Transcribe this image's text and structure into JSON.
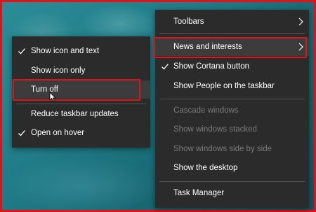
{
  "context_menu": {
    "items": [
      {
        "label": "Toolbars",
        "checked": false,
        "disabled": false,
        "has_submenu": true
      },
      {
        "label": "News and interests",
        "checked": false,
        "disabled": false,
        "has_submenu": true
      },
      {
        "label": "Show Cortana button",
        "checked": true,
        "disabled": false,
        "has_submenu": false
      },
      {
        "label": "Show People on the taskbar",
        "checked": false,
        "disabled": false,
        "has_submenu": false
      },
      {
        "label": "Cascade windows",
        "checked": false,
        "disabled": true,
        "has_submenu": false
      },
      {
        "label": "Show windows stacked",
        "checked": false,
        "disabled": true,
        "has_submenu": false
      },
      {
        "label": "Show windows side by side",
        "checked": false,
        "disabled": true,
        "has_submenu": false
      },
      {
        "label": "Show the desktop",
        "checked": false,
        "disabled": false,
        "has_submenu": false
      },
      {
        "label": "Task Manager",
        "checked": false,
        "disabled": false,
        "has_submenu": false
      }
    ]
  },
  "submenu": {
    "items": [
      {
        "label": "Show icon and text",
        "checked": true
      },
      {
        "label": "Show icon only",
        "checked": false
      },
      {
        "label": "Turn off",
        "checked": false,
        "hovered": true
      },
      {
        "label": "Reduce taskbar updates",
        "checked": false
      },
      {
        "label": "Open on hover",
        "checked": true
      }
    ]
  },
  "colors": {
    "menu_background": "#2b2b2b",
    "highlight_border": "#e0121a",
    "disabled_text": "#7a7a7a"
  },
  "icons": {
    "check": "checkmark-icon",
    "submenu_arrow": "chevron-right-icon",
    "pointer": "mouse-cursor-icon"
  }
}
